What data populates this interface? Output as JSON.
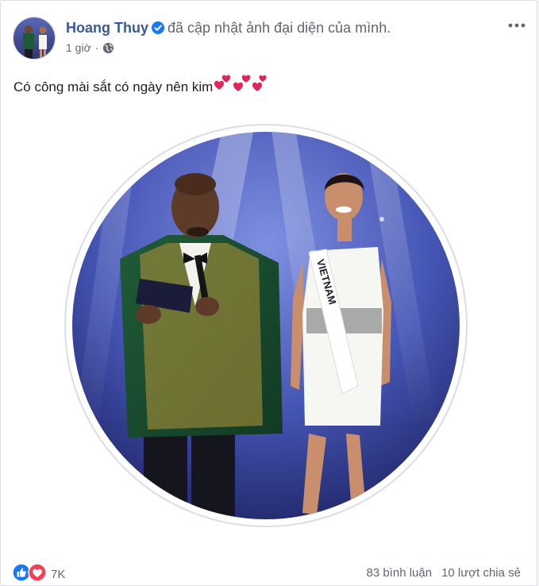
{
  "post": {
    "author": "Hoang Thuy",
    "action": "đã cập nhật ảnh đại diện của mình.",
    "time": "1 giờ",
    "separator": "·",
    "text": "Có công mài sắt có ngày nên kim",
    "photo_sash_text": "VIETNAM"
  },
  "stats": {
    "reactions": "7K",
    "comments": "83 bình luận",
    "shares": "10 lượt chia sẻ"
  },
  "icons": [
    "verified-badge-icon",
    "globe-icon",
    "more-options-icon",
    "heart-emoji-icon",
    "like-reaction-icon",
    "love-reaction-icon"
  ],
  "colors": {
    "author_link": "#385898",
    "meta_text": "#606770",
    "like_blue": "#1877f2",
    "love_red": "#f33e58",
    "heart_emoji": "#e0245e"
  }
}
